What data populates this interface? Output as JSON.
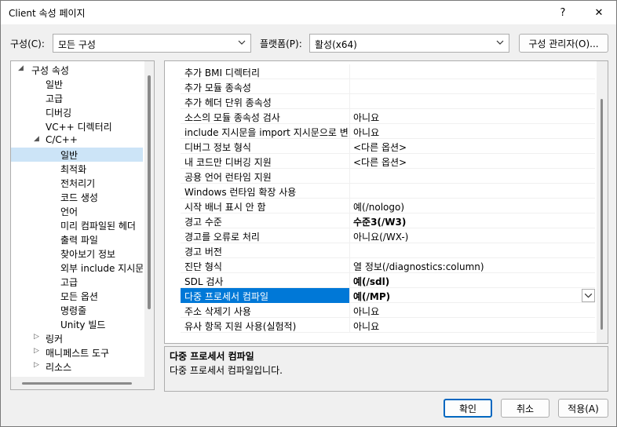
{
  "window": {
    "title": "Client 속성 페이지",
    "help_label": "?",
    "close_label": "✕"
  },
  "config": {
    "config_label": "구성(C):",
    "config_value": "모든 구성",
    "platform_label": "플랫폼(P):",
    "platform_value": "활성(x64)",
    "manager_label": "구성 관리자(O)..."
  },
  "tree": {
    "root": "구성 속성",
    "items": [
      {
        "label": "일반",
        "depth": 1
      },
      {
        "label": "고급",
        "depth": 1
      },
      {
        "label": "디버깅",
        "depth": 1
      },
      {
        "label": "VC++ 디렉터리",
        "depth": 1
      },
      {
        "label": "C/C++",
        "depth": 1,
        "expanded": true
      },
      {
        "label": "일반",
        "depth": 2,
        "selected": true
      },
      {
        "label": "최적화",
        "depth": 2
      },
      {
        "label": "전처리기",
        "depth": 2
      },
      {
        "label": "코드 생성",
        "depth": 2
      },
      {
        "label": "언어",
        "depth": 2
      },
      {
        "label": "미리 컴파일된 헤더",
        "depth": 2
      },
      {
        "label": "출력 파일",
        "depth": 2
      },
      {
        "label": "찾아보기 정보",
        "depth": 2
      },
      {
        "label": "외부 include 지시문",
        "depth": 2
      },
      {
        "label": "고급",
        "depth": 2
      },
      {
        "label": "모든 옵션",
        "depth": 2
      },
      {
        "label": "명령줄",
        "depth": 2
      },
      {
        "label": "Unity 빌드",
        "depth": 2
      },
      {
        "label": "링커",
        "depth": 1,
        "collapsed": true
      },
      {
        "label": "매니페스트 도구",
        "depth": 1,
        "collapsed": true
      },
      {
        "label": "리소스",
        "depth": 1,
        "collapsed": true
      }
    ]
  },
  "properties": [
    {
      "name": "추가 BMI 디렉터리",
      "value": ""
    },
    {
      "name": "추가 모듈 종속성",
      "value": ""
    },
    {
      "name": "추가 헤더 단위 종속성",
      "value": ""
    },
    {
      "name": "소스의 모듈 종속성 검사",
      "value": "아니요"
    },
    {
      "name": "include 지시문을 import 지시문으로 변",
      "value": "아니요"
    },
    {
      "name": "디버그 정보 형식",
      "value": "<다른 옵션>"
    },
    {
      "name": "내 코드만 디버깅 지원",
      "value": "<다른 옵션>"
    },
    {
      "name": "공용 언어 런타임 지원",
      "value": ""
    },
    {
      "name": "Windows 런타임 확장 사용",
      "value": ""
    },
    {
      "name": "시작 배너 표시 안 함",
      "value": "예(/nologo)"
    },
    {
      "name": "경고 수준",
      "value": "수준3(/W3)",
      "bold": true
    },
    {
      "name": "경고를 오류로 처리",
      "value": "아니요(/WX-)"
    },
    {
      "name": "경고 버전",
      "value": ""
    },
    {
      "name": "진단 형식",
      "value": "열 정보(/diagnostics:column)"
    },
    {
      "name": "SDL 검사",
      "value": "예(/sdl)",
      "bold": true
    },
    {
      "name": "다중 프로세서 컴파일",
      "value": "예(/MP)",
      "bold": true,
      "selected": true
    },
    {
      "name": "주소 삭제기 사용",
      "value": "아니요"
    },
    {
      "name": "유사 항목 지원 사용(실험적)",
      "value": "아니요"
    }
  ],
  "description": {
    "title": "다중 프로세서 컴파일",
    "text": "다중 프로세서 컴파일입니다."
  },
  "buttons": {
    "ok": "확인",
    "cancel": "취소",
    "apply": "적용(A)"
  },
  "colors": {
    "selection": "#0078d7",
    "tree_selection": "#cce4f7"
  }
}
